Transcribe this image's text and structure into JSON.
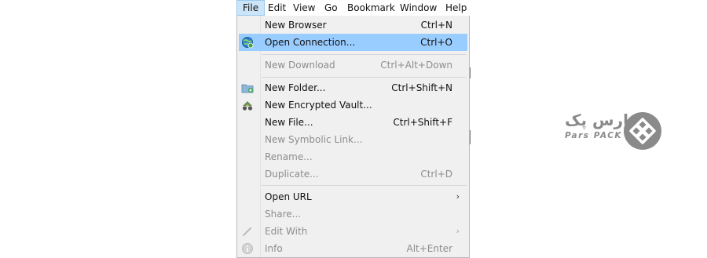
{
  "menubar": {
    "items": [
      {
        "label": "File",
        "active": true
      },
      {
        "label": "Edit"
      },
      {
        "label": "View"
      },
      {
        "label": "Go"
      },
      {
        "label": "Bookmark"
      },
      {
        "label": "Window"
      },
      {
        "label": "Help"
      }
    ]
  },
  "file_menu": {
    "items": [
      {
        "label": "New Browser",
        "shortcut": "Ctrl+N",
        "icon": "",
        "enabled": true
      },
      {
        "label": "Open Connection...",
        "shortcut": "Ctrl+O",
        "icon": "globe-connect-icon",
        "enabled": true,
        "highlighted": true
      },
      {
        "label": "New Download",
        "shortcut": "Ctrl+Alt+Down",
        "icon": "",
        "enabled": false
      },
      {
        "label": "New Folder...",
        "shortcut": "Ctrl+Shift+N",
        "icon": "folder-add-icon",
        "enabled": true
      },
      {
        "label": "New Encrypted Vault...",
        "shortcut": "",
        "icon": "vault-icon",
        "enabled": true
      },
      {
        "label": "New File...",
        "shortcut": "Ctrl+Shift+F",
        "icon": "",
        "enabled": true
      },
      {
        "label": "New Symbolic Link...",
        "shortcut": "",
        "icon": "",
        "enabled": false
      },
      {
        "label": "Rename...",
        "shortcut": "",
        "icon": "",
        "enabled": false
      },
      {
        "label": "Duplicate...",
        "shortcut": "Ctrl+D",
        "icon": "",
        "enabled": false
      },
      {
        "label": "Open URL",
        "shortcut": "",
        "icon": "",
        "enabled": true,
        "submenu": true
      },
      {
        "label": "Share...",
        "shortcut": "",
        "icon": "",
        "enabled": false
      },
      {
        "label": "Edit With",
        "shortcut": "",
        "icon": "pencil-icon",
        "enabled": false,
        "submenu": true
      },
      {
        "label": "Info",
        "shortcut": "Alt+Enter",
        "icon": "info-icon",
        "enabled": false
      }
    ],
    "submenu_arrow": "›"
  },
  "logo": {
    "persian_text": "پارس پک",
    "english_text": "Pars PACK",
    "color": "#8a8a8a"
  },
  "colors": {
    "highlight": "#99ccff",
    "menu_background": "#f0f0f0",
    "active_menubar": "#cce4f7",
    "disabled_text": "#8d8d8d"
  }
}
